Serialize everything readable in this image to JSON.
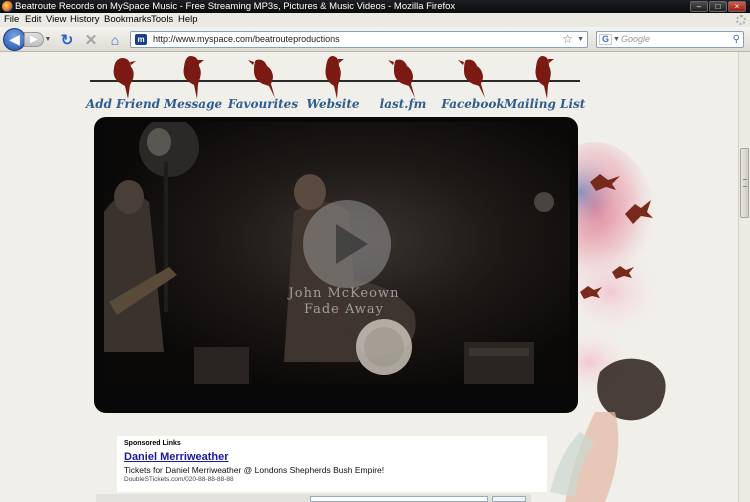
{
  "window": {
    "title": "Beatroute Records on MySpace Music - Free Streaming MP3s, Pictures & Music Videos - Mozilla Firefox"
  },
  "menubar": {
    "items": [
      "File",
      "Edit",
      "View",
      "History",
      "Bookmarks",
      "Tools",
      "Help"
    ]
  },
  "navbar": {
    "url": "http://www.myspace.com/beatrouteproductions",
    "search_placeholder": "Google"
  },
  "page": {
    "nav_links": [
      "Add Friend",
      "Message",
      "Favourites",
      "Website",
      "last.fm",
      "Facebook",
      "Mailing List"
    ],
    "video": {
      "artist": "John McKeown",
      "song": "Fade Away"
    },
    "ads": {
      "header": "Sponsored Links",
      "title": "Daniel Merriweather",
      "description": "Tickets for Daniel Merriweather @ Londons Shepherds Bush Empire!",
      "url": "DoubleSTickets.com/020-88-88-88-88"
    }
  },
  "colors": {
    "nav_link": "#2e5d8e",
    "bird": "#7a1a12",
    "ad_title": "#1a1a9a",
    "page_bg": "#f1efea"
  }
}
